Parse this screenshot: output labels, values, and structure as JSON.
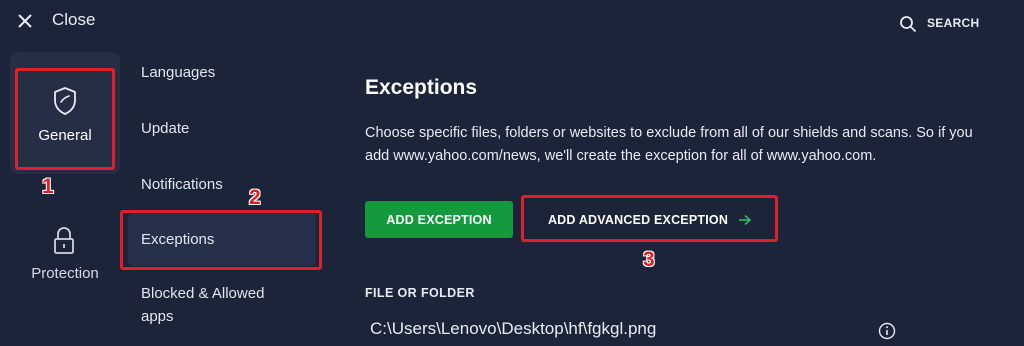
{
  "topbar": {
    "close_label": "Close",
    "search_label": "SEARCH"
  },
  "rail": {
    "items": [
      {
        "label": "General",
        "icon": "shield-icon",
        "active": true
      },
      {
        "label": "Protection",
        "icon": "lock-icon",
        "active": false
      }
    ]
  },
  "submenu": {
    "items": [
      {
        "label": "Languages"
      },
      {
        "label": "Update"
      },
      {
        "label": "Notifications"
      },
      {
        "label": "Exceptions",
        "active": true
      },
      {
        "label": "Blocked & Allowed apps"
      }
    ]
  },
  "main": {
    "title": "Exceptions",
    "description": "Choose specific files, folders or websites to exclude from all of our shields and scans. So if you add www.yahoo.com/news, we'll create the exception for all of www.yahoo.com.",
    "add_exception_label": "ADD EXCEPTION",
    "add_advanced_label": "ADD ADVANCED EXCEPTION",
    "section_label": "FILE OR FOLDER",
    "file_path": "C:\\Users\\Lenovo\\Desktop\\hf\\fgkgl.png"
  },
  "annotations": {
    "step1": "1",
    "step2": "2",
    "step3": "3"
  },
  "colors": {
    "background": "#1c2439",
    "accent_green": "#139a3c",
    "annotation_red": "#e01f26"
  }
}
